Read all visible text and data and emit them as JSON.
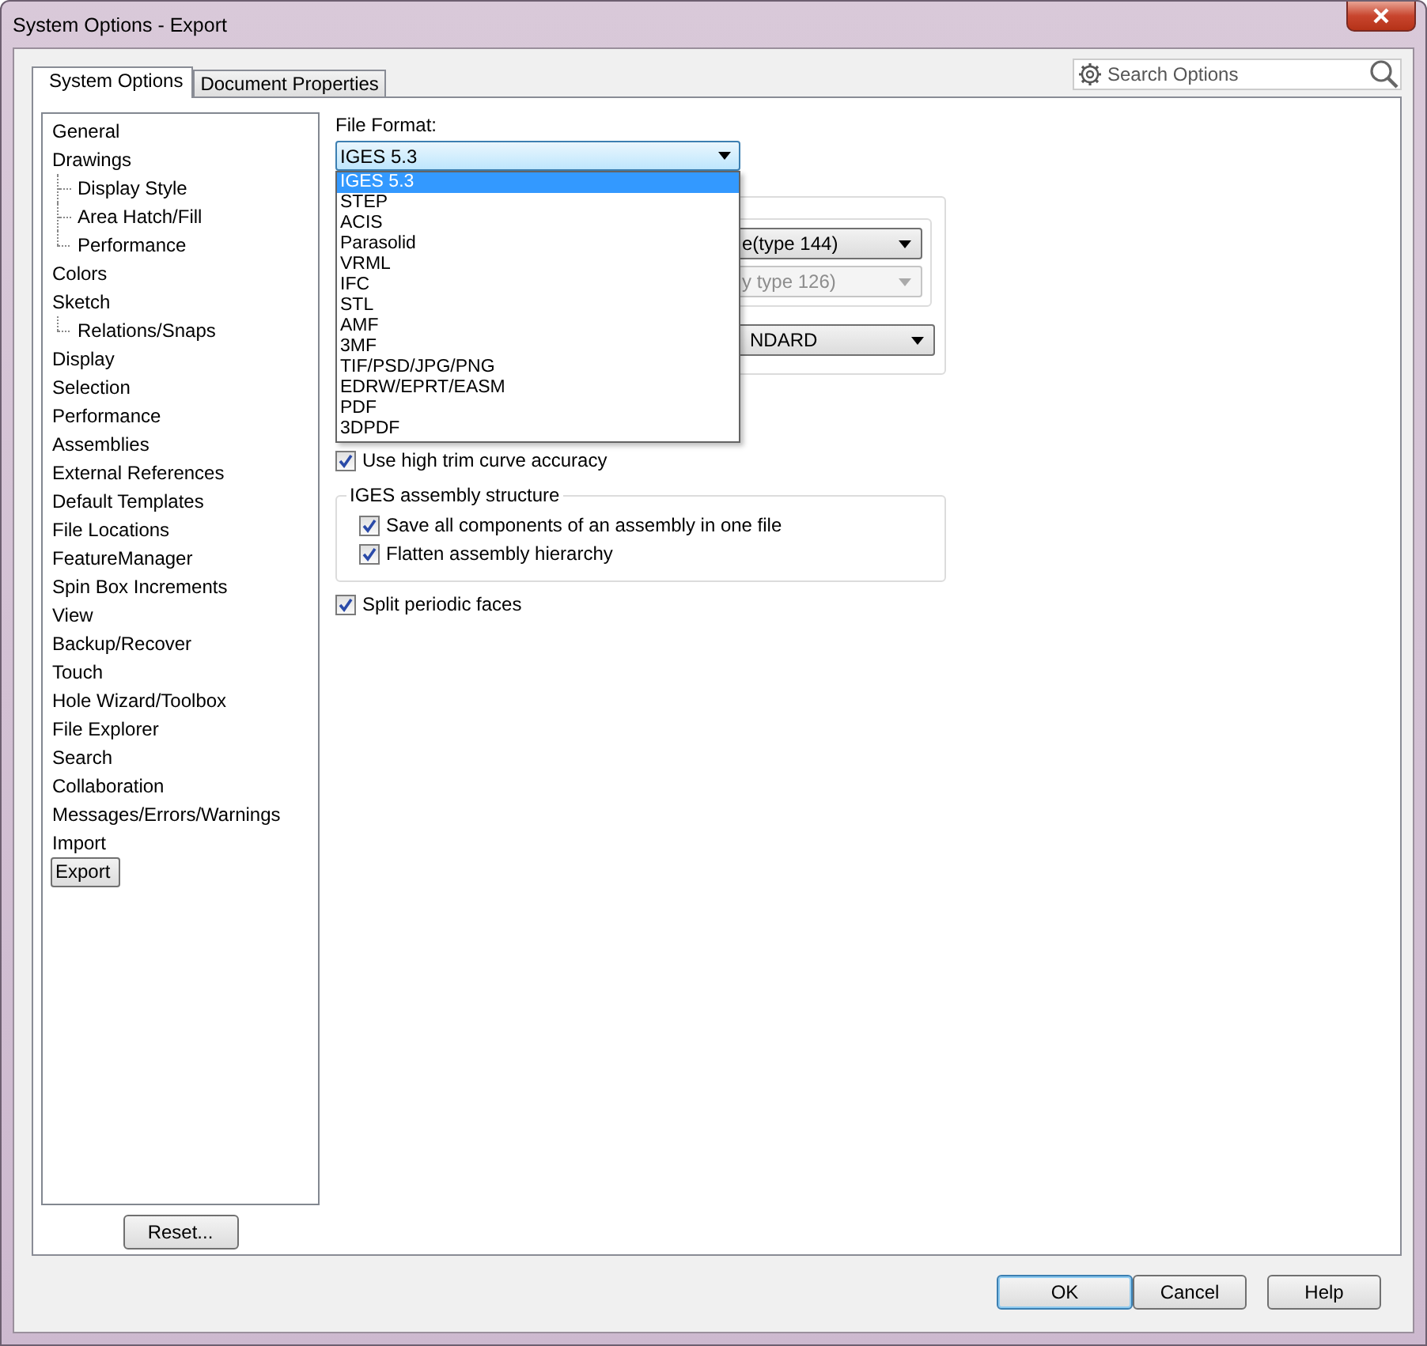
{
  "window": {
    "title": "System Options - Export"
  },
  "tabs": [
    {
      "label": "System Options",
      "selected": true
    },
    {
      "label": "Document Properties",
      "selected": false
    }
  ],
  "search": {
    "placeholder": "Search Options"
  },
  "tree": [
    {
      "label": "General",
      "selected": false
    },
    {
      "label": "Drawings",
      "selected": false,
      "children": [
        {
          "label": "Display Style",
          "selected": false
        },
        {
          "label": "Area Hatch/Fill",
          "selected": false
        },
        {
          "label": "Performance",
          "selected": false
        }
      ]
    },
    {
      "label": "Colors",
      "selected": false
    },
    {
      "label": "Sketch",
      "selected": false,
      "children": [
        {
          "label": "Relations/Snaps",
          "selected": false
        }
      ]
    },
    {
      "label": "Display",
      "selected": false
    },
    {
      "label": "Selection",
      "selected": false
    },
    {
      "label": "Performance",
      "selected": false
    },
    {
      "label": "Assemblies",
      "selected": false
    },
    {
      "label": "External References",
      "selected": false
    },
    {
      "label": "Default Templates",
      "selected": false
    },
    {
      "label": "File Locations",
      "selected": false
    },
    {
      "label": "FeatureManager",
      "selected": false
    },
    {
      "label": "Spin Box Increments",
      "selected": false
    },
    {
      "label": "View",
      "selected": false
    },
    {
      "label": "Backup/Recover",
      "selected": false
    },
    {
      "label": "Touch",
      "selected": false
    },
    {
      "label": "Hole Wizard/Toolbox",
      "selected": false
    },
    {
      "label": "File Explorer",
      "selected": false
    },
    {
      "label": "Search",
      "selected": false
    },
    {
      "label": "Collaboration",
      "selected": false
    },
    {
      "label": "Messages/Errors/Warnings",
      "selected": false
    },
    {
      "label": "Import",
      "selected": false
    },
    {
      "label": "Export",
      "selected": true
    }
  ],
  "reset_button": "Reset...",
  "file_format": {
    "label": "File Format:",
    "value": "IGES 5.3",
    "expanded": true,
    "options": [
      {
        "label": "IGES 5.3",
        "selected": true
      },
      {
        "label": "STEP",
        "selected": false
      },
      {
        "label": "ACIS",
        "selected": false
      },
      {
        "label": "Parasolid",
        "selected": false
      },
      {
        "label": "VRML",
        "selected": false
      },
      {
        "label": "IFC",
        "selected": false
      },
      {
        "label": "STL",
        "selected": false
      },
      {
        "label": "AMF",
        "selected": false
      },
      {
        "label": "3MF",
        "selected": false
      },
      {
        "label": "TIF/PSD/JPG/PNG",
        "selected": false
      },
      {
        "label": "EDRW/EPRT/EASM",
        "selected": false
      },
      {
        "label": "PDF",
        "selected": false
      },
      {
        "label": "3DPDF",
        "selected": false
      }
    ]
  },
  "covered_group": {
    "combos": [
      {
        "value": "e(type 144)",
        "disabled": false
      },
      {
        "value": "y type 126)",
        "disabled": true
      }
    ],
    "combo_3": {
      "value": "NDARD",
      "disabled": false
    }
  },
  "trim_checkbox": {
    "label": "Use high trim curve accuracy",
    "checked": true
  },
  "assembly_group": {
    "title": "IGES assembly structure",
    "checkboxes": [
      {
        "label": "Save all components of an assembly in one file",
        "checked": true
      },
      {
        "label": "Flatten assembly hierarchy",
        "checked": true
      }
    ]
  },
  "split_checkbox": {
    "label": "Split periodic faces",
    "checked": true
  },
  "buttons": [
    {
      "label": "OK",
      "default": true
    },
    {
      "label": "Cancel",
      "default": false
    },
    {
      "label": "Help",
      "default": false
    }
  ]
}
